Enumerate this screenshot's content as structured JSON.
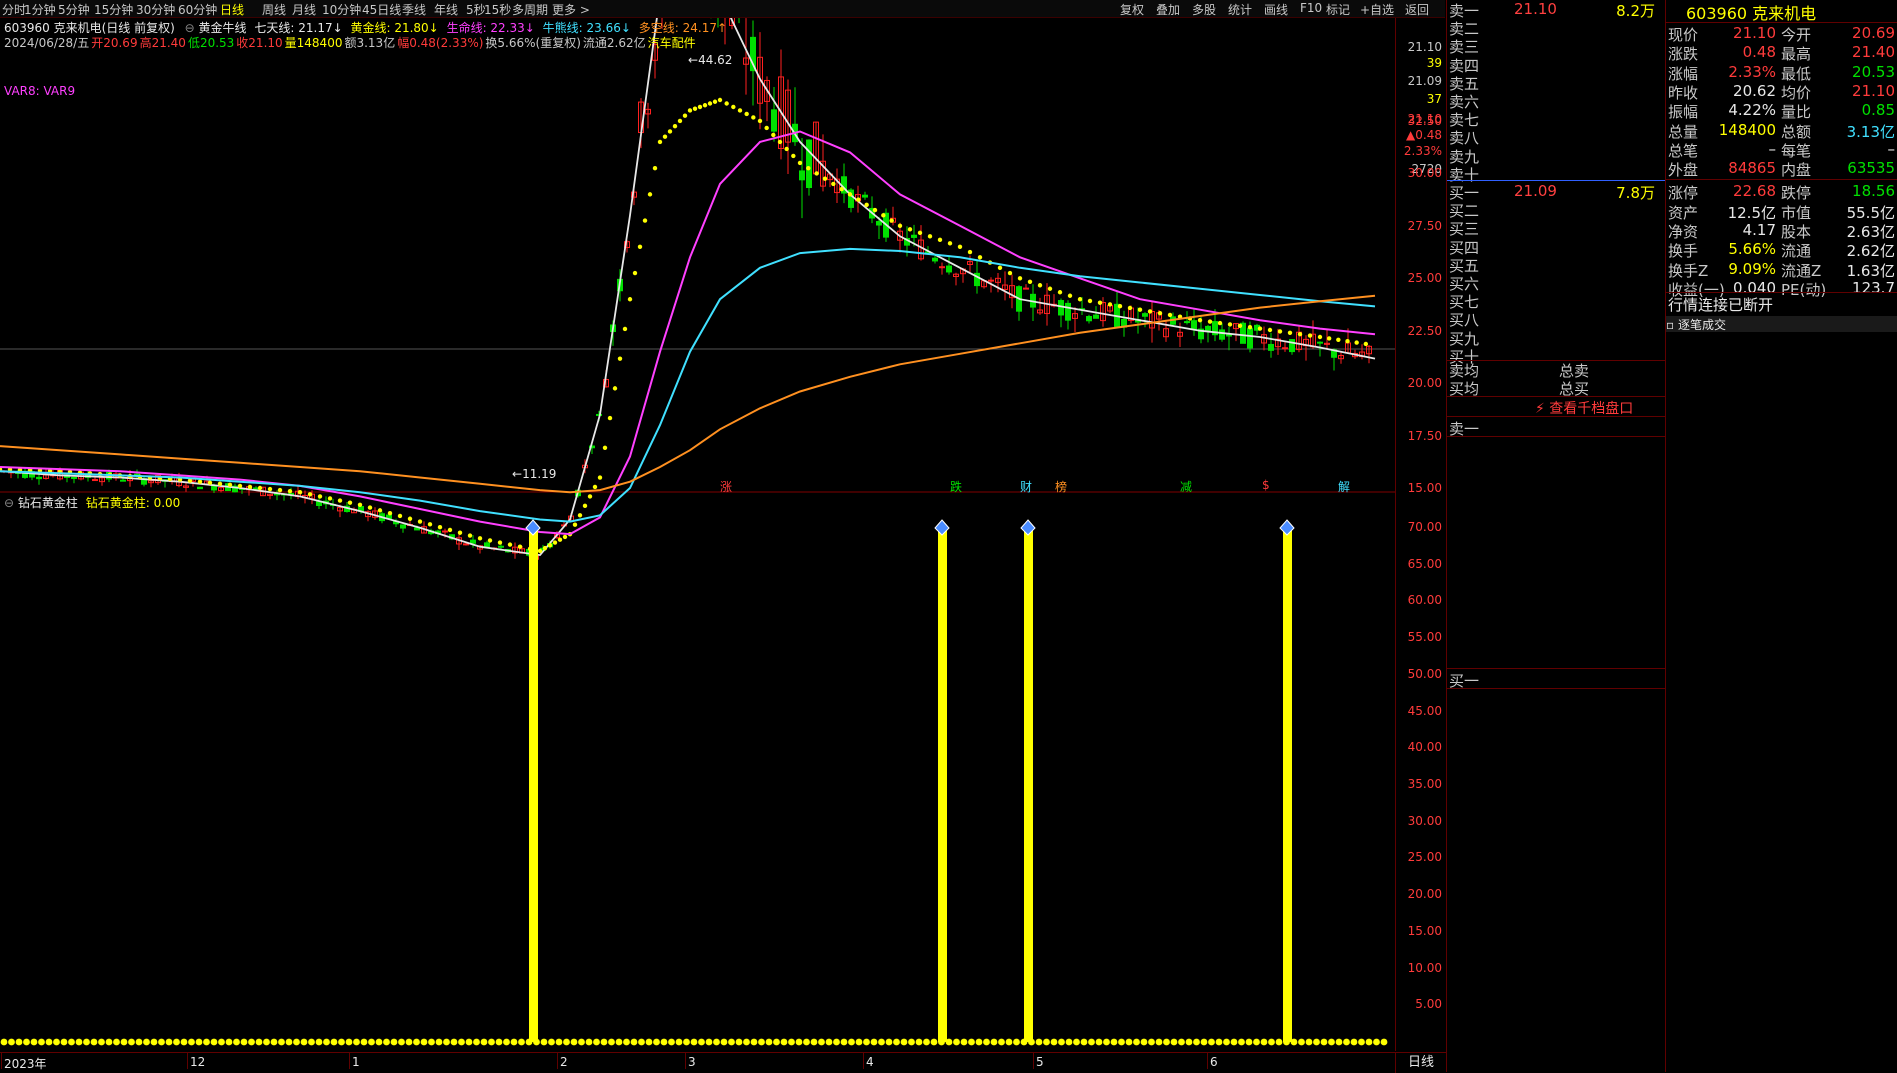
{
  "toolbar": {
    "periods": [
      "分时",
      "1分钟",
      "5分钟",
      "15分钟",
      "30分钟",
      "60分钟",
      "日线",
      "周线",
      "月线",
      "10分钟",
      "45日线",
      "季线",
      "年线",
      "5秒",
      "15秒",
      "多周期",
      "更多 >"
    ],
    "active_period": "日线",
    "right_tools": [
      "复权",
      "叠加",
      "多股",
      "统计",
      "画线",
      "F10",
      "标记",
      "+自选",
      "返回"
    ]
  },
  "header": {
    "stock_line": "603960 克来机电(日线 前复权)",
    "indicator_name": "黄金牛线",
    "ind_values": [
      {
        "text": "七天线: 21.17↓",
        "color": "#e8e8e8"
      },
      {
        "text": "黄金线: 21.80↓",
        "color": "#ffff00"
      },
      {
        "text": "生命线: 22.33↓",
        "color": "#ff40ff"
      },
      {
        "text": "牛熊线: 23.66↓",
        "color": "#40e0ff"
      },
      {
        "text": "多空线: 24.17↑",
        "color": "#ff9020"
      }
    ],
    "bar_info": [
      {
        "text": "2024/06/28/五",
        "color": "#c8c8c8"
      },
      {
        "text": "开20.69",
        "color": "#ff3b3b"
      },
      {
        "text": "高21.40",
        "color": "#ff3b3b"
      },
      {
        "text": "低20.53",
        "color": "#00e000"
      },
      {
        "text": "收21.10",
        "color": "#ff3b3b"
      },
      {
        "text": "量148400",
        "color": "#ffff00"
      },
      {
        "text": "额3.13亿",
        "color": "#c8c8c8"
      },
      {
        "text": "幅0.48(2.33%)",
        "color": "#ff3b3b"
      },
      {
        "text": "换5.66%(重复权)",
        "color": "#c8c8c8"
      },
      {
        "text": "流通2.62亿",
        "color": "#c8c8c8"
      },
      {
        "text": "汽车配件",
        "color": "#ffff00"
      }
    ],
    "var_label": "VAR8: VAR9",
    "peak_label": "44.62",
    "low_label": "11.19"
  },
  "price_axis": {
    "right_top": [
      {
        "text": "21.10",
        "color": "#c8c8c8"
      },
      {
        "text": "39",
        "color": "#ffff00"
      },
      {
        "text": "21.09",
        "color": "#c8c8c8"
      },
      {
        "text": "37",
        "color": "#ffff00"
      },
      {
        "text": "21.10",
        "color": "#ff3b3b"
      },
      {
        "text": "▲0.48",
        "color": "#ff3b3b"
      },
      {
        "text": "2.33%",
        "color": "#ff3b3b"
      },
      {
        "text": "2720",
        "color": "#c8c8c8"
      }
    ],
    "ticks": [
      "32.50",
      "30.00",
      "27.50",
      "25.00",
      "22.50",
      "20.00",
      "17.50",
      "15.00"
    ]
  },
  "event_markers": [
    {
      "text": "涨",
      "color": "#ff3b3b"
    },
    {
      "text": "跌",
      "color": "#00e000"
    },
    {
      "text": "财",
      "color": "#40e0ff"
    },
    {
      "text": "榜",
      "color": "#ff9020"
    },
    {
      "text": "减",
      "color": "#00e000"
    },
    {
      "text": "$",
      "color": "#ff3b3b"
    },
    {
      "text": "解",
      "color": "#40e0ff"
    }
  ],
  "lower_panel": {
    "title": "钻石黄金柱",
    "value_text": "钻石黄金柱: 0.00",
    "ticks": [
      "70.00",
      "65.00",
      "60.00",
      "55.00",
      "50.00",
      "45.00",
      "40.00",
      "35.00",
      "30.00",
      "25.00",
      "20.00",
      "15.00",
      "10.00",
      "5.00"
    ],
    "footer_label": "日线"
  },
  "x_axis": {
    "labels": [
      "2023年",
      "12",
      "1",
      "2",
      "3",
      "4",
      "5",
      "6"
    ]
  },
  "orderbook": {
    "sells": [
      {
        "name": "卖十",
        "price": "",
        "vol": ""
      },
      {
        "name": "卖九",
        "price": "",
        "vol": ""
      },
      {
        "name": "卖八",
        "price": "",
        "vol": ""
      },
      {
        "name": "卖七",
        "price": "",
        "vol": ""
      },
      {
        "name": "卖六",
        "price": "",
        "vol": ""
      },
      {
        "name": "卖五",
        "price": "",
        "vol": ""
      },
      {
        "name": "卖四",
        "price": "",
        "vol": ""
      },
      {
        "name": "卖三",
        "price": "",
        "vol": ""
      },
      {
        "name": "卖二",
        "price": "",
        "vol": ""
      },
      {
        "name": "卖一",
        "price": "21.10",
        "vol": "8.2万"
      }
    ],
    "buys": [
      {
        "name": "买一",
        "price": "21.09",
        "vol": "7.8万"
      },
      {
        "name": "买二",
        "price": "",
        "vol": ""
      },
      {
        "name": "买三",
        "price": "",
        "vol": ""
      },
      {
        "name": "买四",
        "price": "",
        "vol": ""
      },
      {
        "name": "买五",
        "price": "",
        "vol": ""
      },
      {
        "name": "买六",
        "price": "",
        "vol": ""
      },
      {
        "name": "买七",
        "price": "",
        "vol": ""
      },
      {
        "name": "买八",
        "price": "",
        "vol": ""
      },
      {
        "name": "买九",
        "price": "",
        "vol": ""
      },
      {
        "name": "买十",
        "price": "",
        "vol": ""
      }
    ],
    "sell_avg_label": "卖均",
    "total_sell_label": "总卖",
    "buy_avg_label": "买均",
    "total_buy_label": "总买",
    "thousand_button": "查看千档盘口",
    "queue_sell_label": "卖一",
    "queue_buy_label": "买一"
  },
  "quote": {
    "title": "603960 克来机电",
    "rows": [
      {
        "k1": "现价",
        "v1": "21.10",
        "c1": "#ff3b3b",
        "k2": "今开",
        "v2": "20.69",
        "c2": "#ff3b3b"
      },
      {
        "k1": "涨跌",
        "v1": "0.48",
        "c1": "#ff3b3b",
        "k2": "最高",
        "v2": "21.40",
        "c2": "#ff3b3b"
      },
      {
        "k1": "涨幅",
        "v1": "2.33%",
        "c1": "#ff3b3b",
        "k2": "最低",
        "v2": "20.53",
        "c2": "#00e000"
      },
      {
        "k1": "昨收",
        "v1": "20.62",
        "c1": "#e8e8e8",
        "k2": "均价",
        "v2": "21.10",
        "c2": "#ff3b3b"
      },
      {
        "k1": "振幅",
        "v1": "4.22%",
        "c1": "#e8e8e8",
        "k2": "量比",
        "v2": "0.85",
        "c2": "#00e000"
      },
      {
        "k1": "总量",
        "v1": "148400",
        "c1": "#ffff00",
        "k2": "总额",
        "v2": "3.13亿",
        "c2": "#40e0ff"
      },
      {
        "k1": "总笔",
        "v1": "–",
        "c1": "#e8e8e8",
        "k2": "每笔",
        "v2": "–",
        "c2": "#e8e8e8"
      },
      {
        "k1": "外盘",
        "v1": "84865",
        "c1": "#ff3b3b",
        "k2": "内盘",
        "v2": "63535",
        "c2": "#00e000"
      },
      {
        "k1": "涨停",
        "v1": "22.68",
        "c1": "#ff3b3b",
        "k2": "跌停",
        "v2": "18.56",
        "c2": "#00e000"
      },
      {
        "k1": "资产",
        "v1": "12.5亿",
        "c1": "#e8e8e8",
        "k2": "市值",
        "v2": "55.5亿",
        "c2": "#e8e8e8"
      },
      {
        "k1": "净资",
        "v1": "4.17",
        "c1": "#e8e8e8",
        "k2": "股本",
        "v2": "2.63亿",
        "c2": "#e8e8e8"
      },
      {
        "k1": "换手",
        "v1": "5.66%",
        "c1": "#ffff00",
        "k2": "流通",
        "v2": "2.62亿",
        "c2": "#e8e8e8"
      },
      {
        "k1": "换手Z",
        "v1": "9.09%",
        "c1": "#ffff00",
        "k2": "流通Z",
        "v2": "1.63亿",
        "c2": "#e8e8e8"
      },
      {
        "k1": "收益(一)",
        "v1": "0.040",
        "c1": "#e8e8e8",
        "k2": "PE(动)",
        "v2": "123.7",
        "c2": "#e8e8e8"
      }
    ],
    "status": "行情连接已断开",
    "tick_tab": "逐笔成交"
  },
  "chart_data": [
    {
      "type": "line",
      "title": "黄金牛线",
      "x_labels": [
        "2023年",
        "12",
        "1",
        "2",
        "3",
        "4",
        "5",
        "6"
      ],
      "ylim": [
        11.19,
        44.62
      ],
      "highest_close_label": 44.62,
      "lowest_label": 11.19,
      "series": [
        {
          "name": "七天线",
          "color": "#e8e8e8",
          "values": [
            15.8,
            15.6,
            15.5,
            15.3,
            15.0,
            14.6,
            13.9,
            13.1,
            12.2,
            11.8,
            13.5,
            18.5,
            28.0,
            38.5,
            40.5,
            38.5,
            34.5,
            31.5,
            29.0,
            27.0,
            25.5,
            24.0,
            23.5,
            23.0,
            22.5,
            22.2,
            21.7,
            21.17
          ]
        },
        {
          "name": "黄金线",
          "color": "#ffff00",
          "values": [
            15.9,
            15.8,
            15.6,
            15.4,
            15.1,
            14.8,
            14.2,
            13.4,
            12.6,
            12.0,
            12.8,
            15.5,
            24.0,
            31.5,
            33.0,
            33.5,
            32.5,
            30.5,
            29.0,
            27.5,
            26.5,
            25.0,
            24.0,
            23.5,
            23.0,
            22.6,
            22.2,
            21.8
          ]
        },
        {
          "name": "生命线",
          "color": "#ff40ff",
          "values": [
            16.0,
            15.9,
            15.8,
            15.6,
            15.4,
            15.1,
            14.6,
            14.0,
            13.4,
            12.9,
            12.8,
            13.6,
            16.5,
            21.5,
            26.0,
            29.5,
            31.5,
            32.0,
            31.0,
            29.0,
            27.5,
            26.0,
            25.0,
            24.0,
            23.5,
            23.0,
            22.6,
            22.33
          ]
        },
        {
          "name": "牛熊线",
          "color": "#40e0ff",
          "values": [
            15.8,
            15.7,
            15.6,
            15.5,
            15.3,
            15.1,
            14.8,
            14.4,
            13.9,
            13.5,
            13.4,
            13.7,
            15.0,
            18.0,
            21.5,
            24.0,
            25.5,
            26.2,
            26.4,
            26.3,
            26.0,
            25.5,
            25.1,
            24.8,
            24.5,
            24.2,
            23.9,
            23.66
          ]
        },
        {
          "name": "多空线",
          "color": "#ff9020",
          "values": [
            17.0,
            16.8,
            16.6,
            16.4,
            16.2,
            16.0,
            15.8,
            15.5,
            15.2,
            14.9,
            14.8,
            14.9,
            15.3,
            16.0,
            16.8,
            17.8,
            18.8,
            19.6,
            20.3,
            20.9,
            21.4,
            21.9,
            22.4,
            22.8,
            23.2,
            23.6,
            23.9,
            24.17
          ]
        }
      ]
    },
    {
      "type": "bar",
      "title": "钻石黄金柱",
      "ylim": [
        0,
        70
      ],
      "x_labels": [
        "2023年",
        "12",
        "1",
        "2",
        "3",
        "4",
        "5",
        "6"
      ],
      "baseline_value": 0,
      "signals": [
        {
          "value": 70
        },
        {
          "value": 70
        },
        {
          "value": 70
        },
        {
          "value": 70
        }
      ],
      "current_value": 0.0
    }
  ]
}
